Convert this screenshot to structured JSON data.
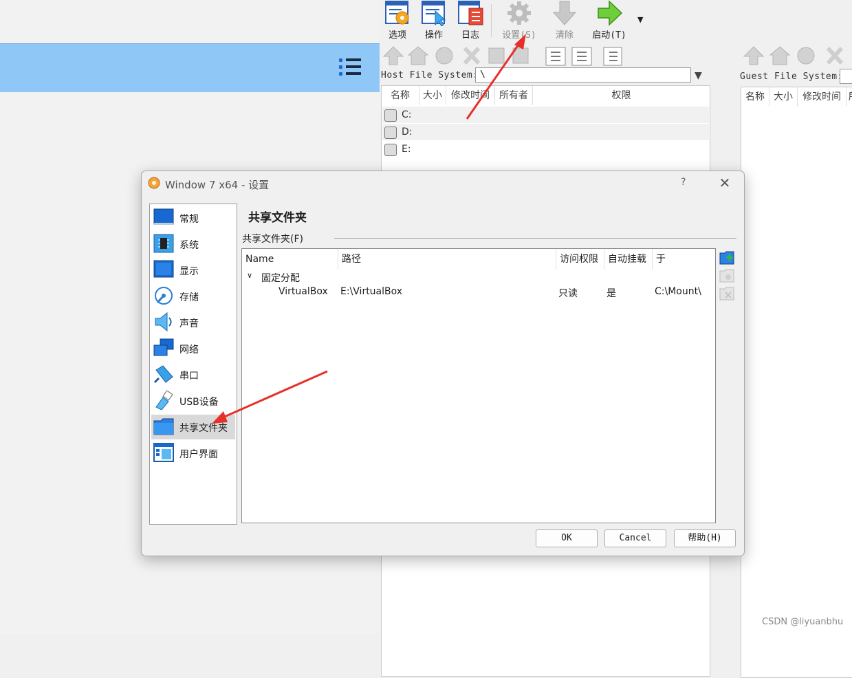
{
  "toolbar": {
    "items": [
      {
        "label": "选项",
        "icon": "options-icon"
      },
      {
        "label": "操作",
        "icon": "operations-icon"
      },
      {
        "label": "日志",
        "icon": "log-icon"
      },
      {
        "label": "设置(S)",
        "icon": "settings-gear-icon"
      },
      {
        "label": "清除",
        "icon": "discard-icon"
      },
      {
        "label": "启动(T)",
        "icon": "start-arrow-icon"
      }
    ],
    "dropdown_icon": "chevron-down-icon"
  },
  "host_panel": {
    "fs_label": "Host File System:",
    "fs_value": "\\",
    "columns": [
      "名称",
      "大小",
      "修改时间",
      "所有者",
      "权限"
    ],
    "drives": [
      "C:",
      "D:",
      "E:"
    ]
  },
  "guest_panel": {
    "fs_label": "Guest File System:",
    "columns": [
      "名称",
      "大小",
      "修改时间",
      "所"
    ]
  },
  "dialog": {
    "title": "Window 7 x64 - 设置",
    "help": "?",
    "nav": [
      {
        "label": "常规",
        "icon": "general-icon"
      },
      {
        "label": "系统",
        "icon": "system-chip-icon"
      },
      {
        "label": "显示",
        "icon": "display-monitor-icon"
      },
      {
        "label": "存储",
        "icon": "storage-disk-icon"
      },
      {
        "label": "声音",
        "icon": "audio-speaker-icon"
      },
      {
        "label": "网络",
        "icon": "network-icon"
      },
      {
        "label": "串口",
        "icon": "serial-port-icon"
      },
      {
        "label": "USB设备",
        "icon": "usb-icon"
      },
      {
        "label": "共享文件夹",
        "icon": "shared-folder-icon"
      },
      {
        "label": "用户界面",
        "icon": "user-interface-icon"
      }
    ],
    "selected_nav": "共享文件夹",
    "page_title": "共享文件夹",
    "group_label": "共享文件夹(F)",
    "table": {
      "headers": [
        "Name",
        "路径",
        "访问权限",
        "自动挂载",
        "于"
      ],
      "group": "固定分配",
      "rows": [
        {
          "name": "VirtualBox",
          "path": "E:\\VirtualBox",
          "access": "只读",
          "automount": "是",
          "mount_point": "C:\\Mount\\"
        }
      ]
    },
    "buttons": {
      "ok": "OK",
      "cancel": "Cancel",
      "help": "帮助(H)"
    }
  },
  "watermark": "CSDN @liyuanbhu",
  "colors": {
    "accent_blue": "#8fc8f7",
    "annotation_red": "#e8302a"
  }
}
